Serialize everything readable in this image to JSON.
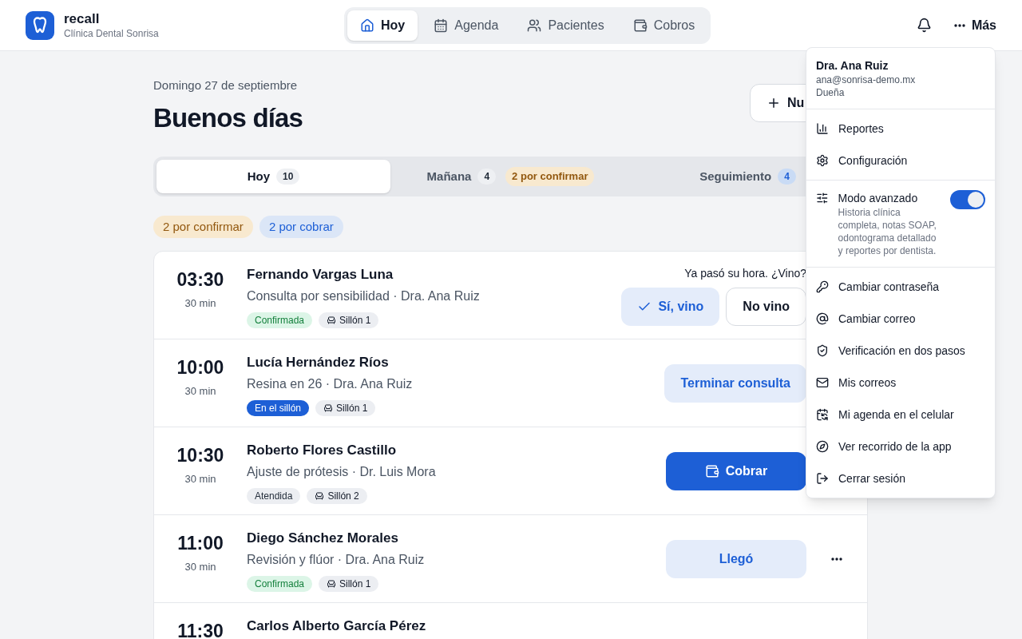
{
  "header": {
    "brand": "recall",
    "clinic": "Clínica Dental Sonrisa",
    "nav": [
      {
        "label": "Hoy",
        "selected": true
      },
      {
        "label": "Agenda",
        "selected": false
      },
      {
        "label": "Pacientes",
        "selected": false
      },
      {
        "label": "Cobros",
        "selected": false
      }
    ],
    "more_label": "Más"
  },
  "page": {
    "date": "Domingo 27 de septiembre",
    "greeting": "Buenos días",
    "new_button": "Nu"
  },
  "tabs": [
    {
      "label": "Hoy",
      "count": "10",
      "highlighted": false,
      "selected": true
    },
    {
      "label": "Mañana",
      "count": "4",
      "highlighted": false,
      "badge": "2 por confirmar",
      "selected": false
    },
    {
      "label": "Seguimiento",
      "count": "4",
      "highlighted": true,
      "selected": false
    }
  ],
  "filters": [
    {
      "label": "2 por confirmar",
      "kind": "warning"
    },
    {
      "label": "2 por cobrar",
      "kind": "info"
    }
  ],
  "appointments": [
    {
      "time": "03:30",
      "duration": "30 min",
      "patient": "Fernando Vargas Luna",
      "detail": "Consulta por sensibilidad · Dra. Ana Ruiz",
      "status": {
        "label": "Confirmada",
        "kind": "confirmed"
      },
      "chair": "Sillón 1",
      "prompt": "Ya pasó su hora. ¿Vino?",
      "actions": [
        {
          "kind": "soft-check",
          "label": "Sí, vino"
        },
        {
          "kind": "outline",
          "label": "No vino"
        }
      ]
    },
    {
      "time": "10:00",
      "duration": "30 min",
      "patient": "Lucía Hernández Ríos",
      "detail": "Resina en 26 · Dra. Ana Ruiz",
      "status": {
        "label": "En el sillón",
        "kind": "in-chair"
      },
      "chair": "Sillón 1",
      "actions": [
        {
          "kind": "soft",
          "label": "Terminar consulta"
        }
      ]
    },
    {
      "time": "10:30",
      "duration": "30 min",
      "patient": "Roberto Flores Castillo",
      "detail": "Ajuste de prótesis · Dr. Luis Mora",
      "status": {
        "label": "Atendida",
        "kind": "done"
      },
      "chair": "Sillón 2",
      "actions": [
        {
          "kind": "pay",
          "label": "Cobrar"
        }
      ]
    },
    {
      "time": "11:00",
      "duration": "30 min",
      "patient": "Diego Sánchez Morales",
      "detail": "Revisión y flúor · Dra. Ana Ruiz",
      "status": {
        "label": "Confirmada",
        "kind": "confirmed"
      },
      "chair": "Sillón 1",
      "actions": [
        {
          "kind": "soft",
          "label": "Llegó"
        }
      ],
      "more": true
    },
    {
      "time": "11:30",
      "patient": "Carlos Alberto García Pérez"
    }
  ],
  "menu": {
    "user": {
      "name": "Dra. Ana Ruiz",
      "email": "ana@sonrisa-demo.mx",
      "role": "Dueña"
    },
    "groups": [
      [
        {
          "kind": "link",
          "label": "Reportes"
        },
        {
          "kind": "link",
          "label": "Configuración"
        }
      ],
      [
        {
          "kind": "toggle",
          "label": "Modo avanzado",
          "description": "Historia clínica completa, notas SOAP, odontograma detallado y reportes por dentista.",
          "on": true
        }
      ],
      [
        {
          "kind": "link",
          "label": "Cambiar contraseña"
        },
        {
          "kind": "link",
          "label": "Cambiar correo"
        },
        {
          "kind": "link",
          "label": "Verificación en dos pasos"
        },
        {
          "kind": "link",
          "label": "Mis correos"
        },
        {
          "kind": "link",
          "label": "Mi agenda en el celular"
        },
        {
          "kind": "link",
          "label": "Ver recorrido de la app"
        },
        {
          "kind": "link",
          "label": "Cerrar sesión"
        }
      ]
    ]
  }
}
